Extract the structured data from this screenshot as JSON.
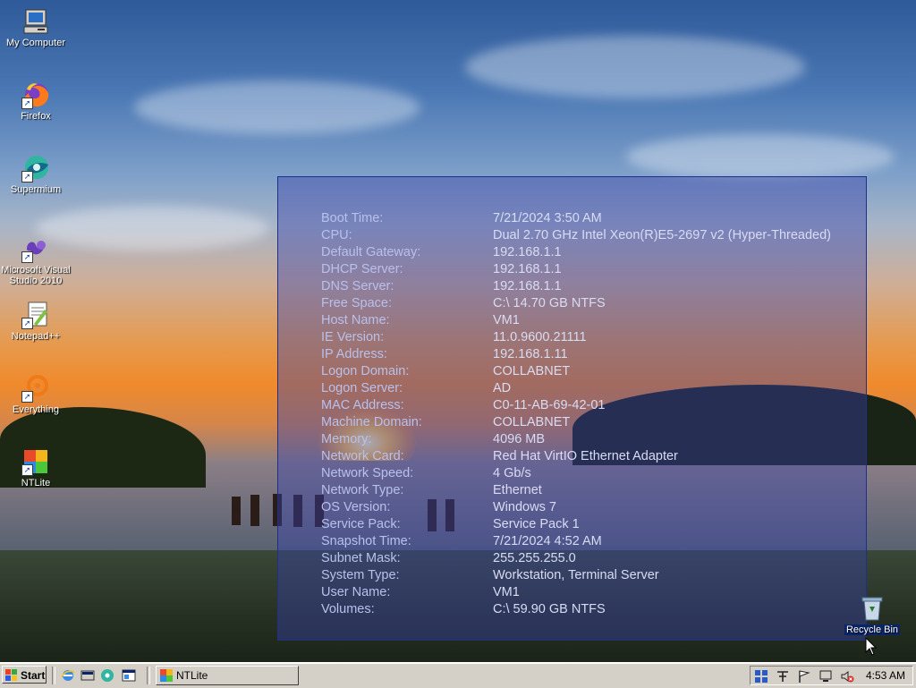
{
  "desktop": {
    "icons": [
      {
        "label": "My Computer",
        "icon": "computer-icon"
      },
      {
        "label": "Firefox",
        "icon": "firefox-icon"
      },
      {
        "label": "Supermium",
        "icon": "supermium-icon"
      },
      {
        "label": "Microsoft Visual Studio 2010",
        "icon": "visual-studio-icon"
      },
      {
        "label": "Notepad++",
        "icon": "notepadpp-icon"
      },
      {
        "label": "Everything",
        "icon": "everything-icon"
      },
      {
        "label": "NTLite",
        "icon": "ntlite-icon"
      },
      {
        "label": "Recycle Bin",
        "icon": "recycle-bin-icon"
      }
    ]
  },
  "info": {
    "rows": [
      {
        "label": "Boot Time:",
        "value": "7/21/2024 3:50 AM"
      },
      {
        "label": "CPU:",
        "value": "Dual 2.70 GHz Intel Xeon(R)E5-2697 v2 (Hyper-Threaded)"
      },
      {
        "label": "Default Gateway:",
        "value": "192.168.1.1"
      },
      {
        "label": "DHCP Server:",
        "value": "192.168.1.1"
      },
      {
        "label": "DNS Server:",
        "value": "192.168.1.1"
      },
      {
        "label": "Free Space:",
        "value": "C:\\ 14.70 GB NTFS"
      },
      {
        "label": "Host Name:",
        "value": "VM1"
      },
      {
        "label": "IE Version:",
        "value": "11.0.9600.21111"
      },
      {
        "label": "IP Address:",
        "value": "192.168.1.11"
      },
      {
        "label": "Logon Domain:",
        "value": "COLLABNET"
      },
      {
        "label": "Logon Server:",
        "value": "AD"
      },
      {
        "label": "MAC Address:",
        "value": "C0-11-AB-69-42-01"
      },
      {
        "label": "Machine Domain:",
        "value": "COLLABNET"
      },
      {
        "label": "Memory:",
        "value": "4096 MB"
      },
      {
        "label": "Network Card:",
        "value": "Red Hat VirtIO Ethernet Adapter"
      },
      {
        "label": "Network Speed:",
        "value": "4 Gb/s"
      },
      {
        "label": "Network Type:",
        "value": "Ethernet"
      },
      {
        "label": "OS Version:",
        "value": "Windows 7"
      },
      {
        "label": "Service Pack:",
        "value": "Service Pack 1"
      },
      {
        "label": "Snapshot Time:",
        "value": "7/21/2024 4:52 AM"
      },
      {
        "label": "Subnet Mask:",
        "value": "255.255.255.0"
      },
      {
        "label": "System Type:",
        "value": "Workstation, Terminal Server"
      },
      {
        "label": "User Name:",
        "value": "VM1"
      },
      {
        "label": "Volumes:",
        "value": "C:\\ 59.90 GB NTFS"
      }
    ]
  },
  "taskbar": {
    "start_label": "Start",
    "quick_launch": [
      "ie-icon",
      "show-desktop-icon",
      "supermium-icon",
      "explorer-icon"
    ],
    "tasks": [
      {
        "label": "NTLite",
        "icon": "ntlite-icon"
      }
    ],
    "tray_icons": [
      "network-icon",
      "input-icon",
      "flag-icon",
      "display-icon",
      "volume-muted-icon"
    ],
    "clock": "4:53 AM"
  }
}
